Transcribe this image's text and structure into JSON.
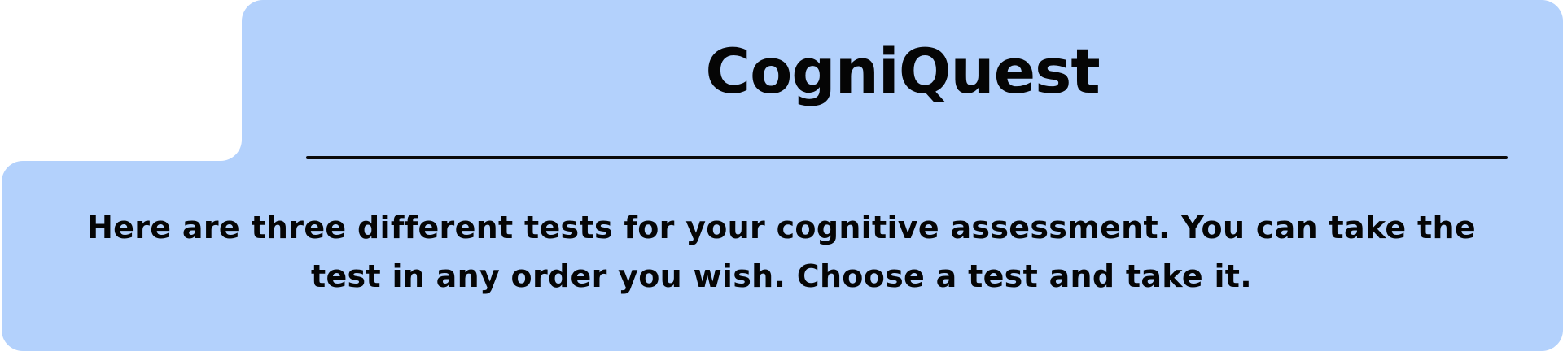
{
  "header": {
    "title": "CogniQuest"
  },
  "intro": {
    "text": "Here are three different tests for your cognitive assessment. You can take the test in any order you wish. Choose a test and take it."
  },
  "colors": {
    "panel_background": "#b3d1fc",
    "text": "#050505",
    "page_background": "#ffffff"
  }
}
